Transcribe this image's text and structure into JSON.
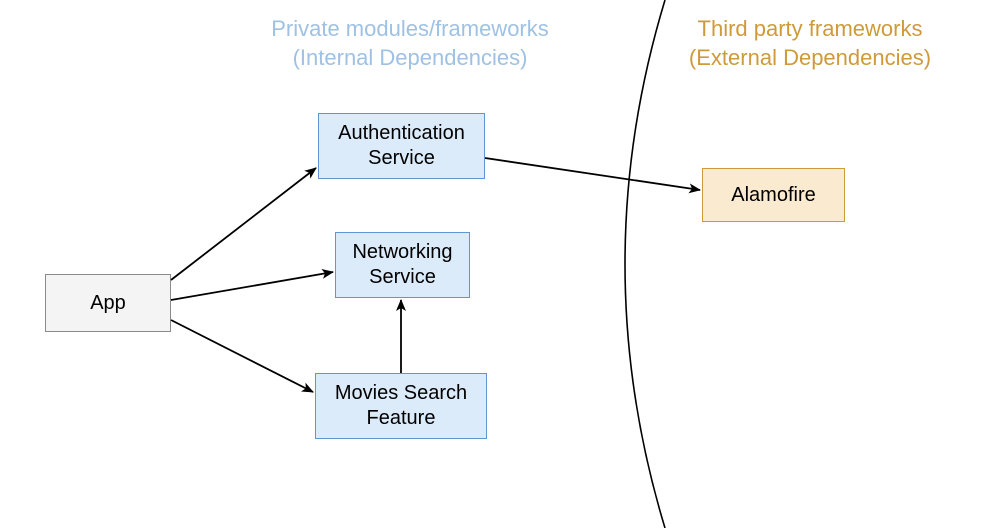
{
  "sections": {
    "private": {
      "title_line1": "Private modules/frameworks",
      "title_line2": "(Internal Dependencies)"
    },
    "third_party": {
      "title_line1": "Third party frameworks",
      "title_line2": "(External Dependencies)"
    }
  },
  "nodes": {
    "app": {
      "label": "App"
    },
    "auth": {
      "label_line1": "Authentication",
      "label_line2": "Service"
    },
    "networking": {
      "label_line1": "Networking",
      "label_line2": "Service"
    },
    "movies": {
      "label_line1": "Movies Search",
      "label_line2": "Feature"
    },
    "alamofire": {
      "label": "Alamofire"
    }
  },
  "edges": [
    {
      "from": "app",
      "to": "auth"
    },
    {
      "from": "app",
      "to": "networking"
    },
    {
      "from": "app",
      "to": "movies"
    },
    {
      "from": "movies",
      "to": "networking"
    },
    {
      "from": "auth",
      "to": "alamofire"
    }
  ],
  "colors": {
    "private_label": "#9fc1e3",
    "third_label": "#cf9a3a",
    "internal_fill": "#dcebfa",
    "internal_border": "#5e97d1",
    "external_fill": "#faebd0",
    "external_border": "#cf9a3a",
    "arrow": "#000000"
  }
}
